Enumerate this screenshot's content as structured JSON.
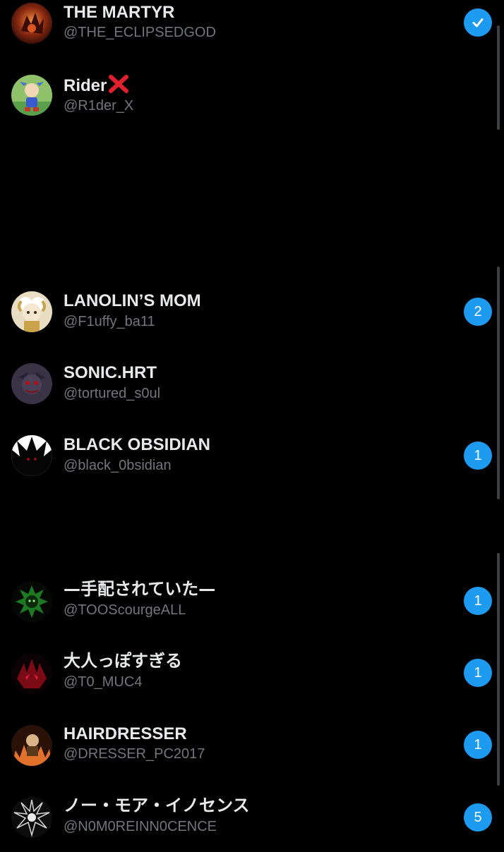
{
  "accounts": [
    {
      "name": "THE MARTYR",
      "handle": "@THE_ECLIPSEDGOD",
      "indicator": "check",
      "avatar_icon": "fiery-hedgehog-avatar"
    },
    {
      "name": "Rider",
      "handle": "@R1der_X",
      "indicator": "",
      "avatar_icon": "cartoon-hedgehog-avatar",
      "name_suffix_icon": "red-x-emoji"
    },
    {
      "name": "LANOLIN’S MOM",
      "handle": "@F1uffy_ba11",
      "indicator": "2",
      "avatar_icon": "sheep-girl-avatar"
    },
    {
      "name": "SONIC.HRT",
      "handle": "@tortured_s0ul",
      "indicator": "",
      "avatar_icon": "dark-hedgehog-avatar"
    },
    {
      "name": "BLACK OBSIDIAN",
      "handle": "@black_0bsidian",
      "indicator": "1",
      "avatar_icon": "black-spiky-avatar"
    },
    {
      "name": "—手配されていた—",
      "handle": "@TOOScourgeALL",
      "indicator": "1",
      "avatar_icon": "green-scourge-avatar"
    },
    {
      "name": "大人っぽすぎる",
      "handle": "@T0_MUC4",
      "indicator": "1",
      "avatar_icon": "red-demon-avatar"
    },
    {
      "name": "HAIRDRESSER",
      "handle": "@DRESSER_PC2017",
      "indicator": "1",
      "avatar_icon": "fire-character-avatar"
    },
    {
      "name": "ノー・モア・イノセンス",
      "handle": "@N0M0REINN0CENCE",
      "indicator": "5",
      "avatar_icon": "monochrome-spiky-avatar"
    }
  ],
  "colors": {
    "background": "#000000",
    "name_text": "#e7e9ea",
    "handle_text": "#71767b",
    "badge_blue": "#1d9bf0",
    "scrollbar": "#3e4144"
  }
}
